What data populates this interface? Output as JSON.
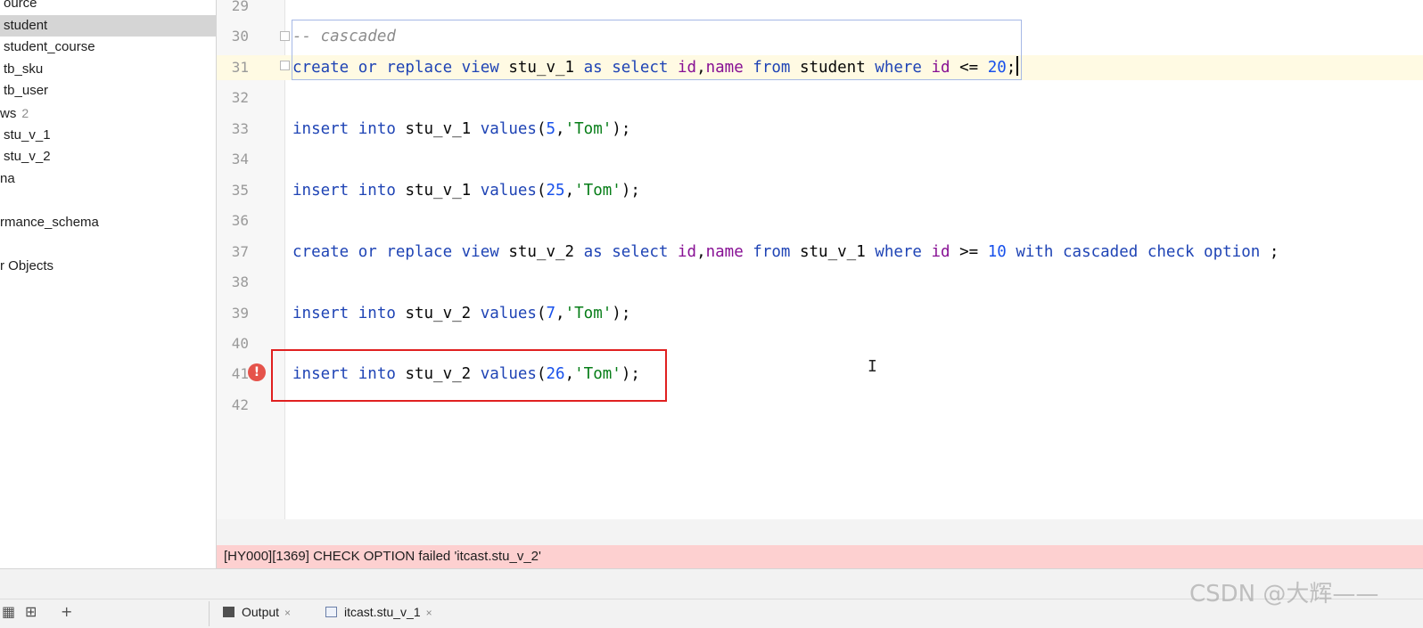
{
  "tree": {
    "items": [
      {
        "label": "ource",
        "indent": 4,
        "selected": false
      },
      {
        "label": "student",
        "indent": 4,
        "selected": true
      },
      {
        "label": "student_course",
        "indent": 4,
        "selected": false
      },
      {
        "label": "tb_sku",
        "indent": 4,
        "selected": false
      },
      {
        "label": "tb_user",
        "indent": 4,
        "selected": false
      },
      {
        "label": "ws",
        "count": "2",
        "indent": 0,
        "selected": false
      },
      {
        "label": "stu_v_1",
        "indent": 4,
        "selected": false
      },
      {
        "label": "stu_v_2",
        "indent": 4,
        "selected": false
      },
      {
        "label": "na",
        "indent": 0,
        "selected": false
      },
      {
        "label": "",
        "indent": 0,
        "selected": false
      },
      {
        "label": "rmance_schema",
        "indent": 0,
        "selected": false
      },
      {
        "label": "",
        "indent": 0,
        "selected": false
      },
      {
        "label": "r Objects",
        "indent": 0,
        "selected": false
      }
    ]
  },
  "editor": {
    "current_line": "31",
    "error_line": "41",
    "lines": [
      {
        "n": "29",
        "tokens": []
      },
      {
        "n": "30",
        "tokens": [
          {
            "t": "-- cascaded",
            "c": "cmt"
          }
        ]
      },
      {
        "n": "31",
        "tokens": [
          {
            "t": "create or replace view ",
            "c": "kw"
          },
          {
            "t": "stu_v_1 ",
            "c": ""
          },
          {
            "t": "as select ",
            "c": "kw"
          },
          {
            "t": "id",
            "c": "col"
          },
          {
            "t": ",",
            "c": ""
          },
          {
            "t": "name ",
            "c": "col"
          },
          {
            "t": "from ",
            "c": "kw"
          },
          {
            "t": "student ",
            "c": ""
          },
          {
            "t": "where ",
            "c": "kw"
          },
          {
            "t": "id ",
            "c": "col"
          },
          {
            "t": "<= ",
            "c": ""
          },
          {
            "t": "20",
            "c": "num"
          },
          {
            "t": ";",
            "c": ""
          }
        ]
      },
      {
        "n": "32",
        "tokens": []
      },
      {
        "n": "33",
        "tokens": [
          {
            "t": "insert into ",
            "c": "kw"
          },
          {
            "t": "stu_v_1 ",
            "c": ""
          },
          {
            "t": "values",
            "c": "kw"
          },
          {
            "t": "(",
            "c": ""
          },
          {
            "t": "5",
            "c": "num"
          },
          {
            "t": ",",
            "c": ""
          },
          {
            "t": "'Tom'",
            "c": "str"
          },
          {
            "t": ");",
            "c": ""
          }
        ]
      },
      {
        "n": "34",
        "tokens": []
      },
      {
        "n": "35",
        "tokens": [
          {
            "t": "insert into ",
            "c": "kw"
          },
          {
            "t": "stu_v_1 ",
            "c": ""
          },
          {
            "t": "values",
            "c": "kw"
          },
          {
            "t": "(",
            "c": ""
          },
          {
            "t": "25",
            "c": "num"
          },
          {
            "t": ",",
            "c": ""
          },
          {
            "t": "'Tom'",
            "c": "str"
          },
          {
            "t": ");",
            "c": ""
          }
        ]
      },
      {
        "n": "36",
        "tokens": []
      },
      {
        "n": "37",
        "tokens": [
          {
            "t": "create or replace view ",
            "c": "kw"
          },
          {
            "t": "stu_v_2 ",
            "c": ""
          },
          {
            "t": "as select ",
            "c": "kw"
          },
          {
            "t": "id",
            "c": "col"
          },
          {
            "t": ",",
            "c": ""
          },
          {
            "t": "name ",
            "c": "col"
          },
          {
            "t": "from ",
            "c": "kw"
          },
          {
            "t": "stu_v_1 ",
            "c": ""
          },
          {
            "t": "where ",
            "c": "kw"
          },
          {
            "t": "id ",
            "c": "col"
          },
          {
            "t": ">= ",
            "c": ""
          },
          {
            "t": "10 ",
            "c": "num"
          },
          {
            "t": "with cascaded check option ",
            "c": "kw"
          },
          {
            "t": ";",
            "c": ""
          }
        ]
      },
      {
        "n": "38",
        "tokens": []
      },
      {
        "n": "39",
        "tokens": [
          {
            "t": "insert into ",
            "c": "kw"
          },
          {
            "t": "stu_v_2 ",
            "c": ""
          },
          {
            "t": "values",
            "c": "kw"
          },
          {
            "t": "(",
            "c": ""
          },
          {
            "t": "7",
            "c": "num"
          },
          {
            "t": ",",
            "c": ""
          },
          {
            "t": "'Tom'",
            "c": "str"
          },
          {
            "t": ");",
            "c": ""
          }
        ]
      },
      {
        "n": "40",
        "tokens": []
      },
      {
        "n": "41",
        "tokens": [
          {
            "t": "insert into ",
            "c": "kw"
          },
          {
            "t": "stu_v_2 ",
            "c": ""
          },
          {
            "t": "values",
            "c": "kw"
          },
          {
            "t": "(",
            "c": ""
          },
          {
            "t": "26",
            "c": "num"
          },
          {
            "t": ",",
            "c": ""
          },
          {
            "t": "'Tom'",
            "c": "str"
          },
          {
            "t": ");",
            "c": ""
          }
        ]
      },
      {
        "n": "42",
        "tokens": []
      }
    ]
  },
  "error_bar": {
    "message": "[HY000][1369] CHECK OPTION failed 'itcast.stu_v_2'"
  },
  "bottom_tabs": {
    "output_label": "Output",
    "table_label": "itcast.stu_v_1",
    "close_glyph": "×"
  },
  "watermark": "CSDN @大辉——",
  "colors": {
    "keyword": "#1f44b5",
    "column": "#871094",
    "number": "#1750eb",
    "string": "#067d17",
    "comment": "#8c8c8c",
    "error_bar": "#fdd0d0",
    "error_highlight": "#e02020"
  },
  "icons": {
    "error_marker": "error-circle-icon",
    "fold_marker": "fold-icon",
    "add_tab": "plus-icon",
    "output_tab": "terminal-icon",
    "table_tab": "table-icon"
  }
}
